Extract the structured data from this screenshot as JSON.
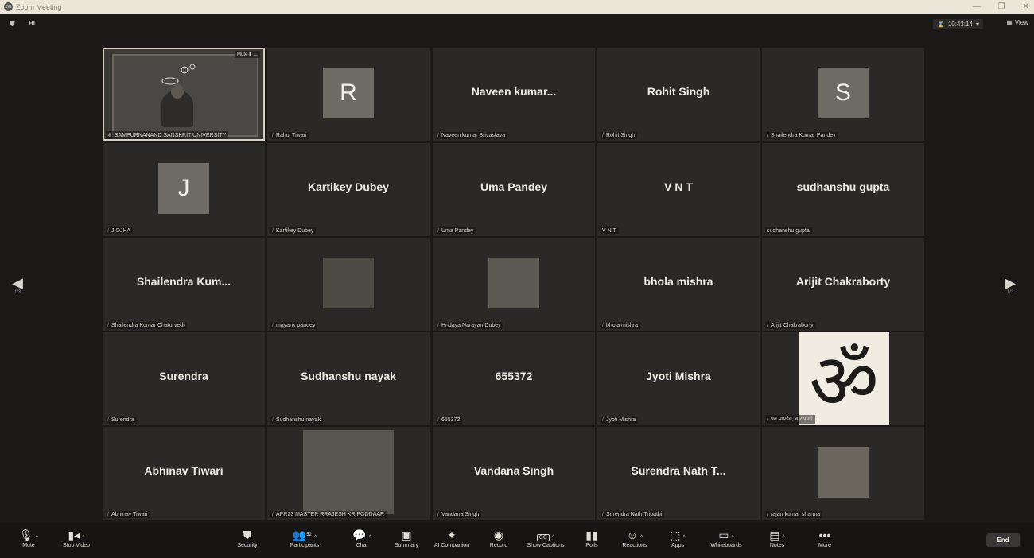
{
  "window": {
    "title": "Zoom Meeting"
  },
  "topbar": {
    "badge": "HI",
    "time": "10:43:14",
    "view_label": "View"
  },
  "self_tile": {
    "label": "SAMPURNANAND SANSKRIT UNIVERSITY",
    "mute_label": "Mute"
  },
  "tiles": [
    {
      "big": "",
      "avatar": "R",
      "label": "Rahul Tiwari"
    },
    {
      "big": "Naveen  kumar...",
      "avatar": "",
      "label": "Naveen  kumar Srivastava"
    },
    {
      "big": "Rohit Singh",
      "avatar": "",
      "label": "Rohit Singh"
    },
    {
      "big": "",
      "avatar": "S",
      "label": "Shailendra Kumar Pandey"
    },
    {
      "big": "",
      "avatar": "J",
      "label": "J OJHA"
    },
    {
      "big": "Kartikey Dubey",
      "avatar": "",
      "label": "Kartikey Dubey"
    },
    {
      "big": "Uma Pandey",
      "avatar": "",
      "label": "Uma Pandey"
    },
    {
      "big": "V N T",
      "avatar": "",
      "label": "V N T"
    },
    {
      "big": "sudhanshu gupta",
      "avatar": "",
      "label": "sudhanshu gupta"
    },
    {
      "big": "Shailendra  Kum...",
      "avatar": "",
      "label": "Shailendra Kumar Chaturvedi"
    },
    {
      "big": "",
      "avatar": "",
      "label": "mayank pandey"
    },
    {
      "big": "",
      "avatar": "",
      "label": "Hridaya Narayan Dubey"
    },
    {
      "big": "bhola mishra",
      "avatar": "",
      "label": "bhola mishra"
    },
    {
      "big": "Arijit Chakraborty",
      "avatar": "",
      "label": "Arijit Chakraborty"
    },
    {
      "big": "Surendra",
      "avatar": "",
      "label": "Surendra"
    },
    {
      "big": "Sudhanshu nayak",
      "avatar": "",
      "label": "Sudhanshu nayak"
    },
    {
      "big": "655372",
      "avatar": "",
      "label": "655372"
    },
    {
      "big": "Jyoti Mishra",
      "avatar": "",
      "label": "Jyoti Mishra"
    },
    {
      "big": "",
      "avatar": "",
      "label": "पत पाण्डेय, वाराणसी"
    },
    {
      "big": "Abhinav Tiwari",
      "avatar": "",
      "label": "Abhinav Tiwari"
    },
    {
      "big": "",
      "avatar": "",
      "label": "APR23 MASTER  RRAJESH KR PODDAAR"
    },
    {
      "big": "Vandana Singh",
      "avatar": "",
      "label": "Vandana Singh"
    },
    {
      "big": "Surendra Nath T...",
      "avatar": "",
      "label": "Surendra Nath Tripathi"
    },
    {
      "big": "",
      "avatar": "",
      "label": "rajan kumar sharma"
    }
  ],
  "pagination": {
    "left": "1/3",
    "right": "1/3"
  },
  "toolbar": {
    "mute": "Mute",
    "stop_video": "Stop Video",
    "security": "Security",
    "participants": "Participants",
    "participants_count": "52",
    "chat": "Chat",
    "summary": "Summary",
    "ai_companion": "AI Companion",
    "record": "Record",
    "show_captions": "Show Captions",
    "cc_badge": "CC",
    "polls": "Polls",
    "reactions": "Reactions",
    "apps": "Apps",
    "whiteboards": "Whiteboards",
    "notes": "Notes",
    "more": "More",
    "more_dots": "•••",
    "end": "End"
  },
  "colors": {
    "background": "#1a1918",
    "tile": "#2a2927",
    "titlebar": "#ece6d8"
  }
}
